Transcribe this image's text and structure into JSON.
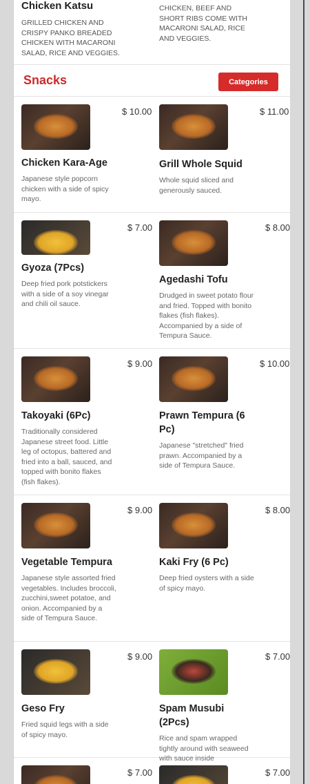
{
  "top": {
    "left": {
      "name": "Chicken Katsu",
      "desc": "GRILLED CHICKEN AND CRISPY PANKO BREADED CHICKEN WITH MACARONI SALAD, RICE AND VEGGIES."
    },
    "right": {
      "desc": "CHICKEN, BEEF AND SHORT RIBS COME WITH MACARONI SALAD, RICE AND VEGGIES."
    }
  },
  "section": {
    "title": "Snacks",
    "categories_label": "Categories"
  },
  "rows": [
    [
      {
        "name": "Chicken Kara-Age",
        "price": "$ 10.00",
        "desc": "Japanese style popcorn chicken with a side of spicy mayo."
      },
      {
        "name": "Grill Whole Squid",
        "price": "$ 11.00",
        "desc": "Whole squid sliced and generously sauced."
      }
    ],
    [
      {
        "name": "Gyoza (7Pcs)",
        "price": "$ 7.00",
        "desc": "Deep fried pork potstickers with a side of a soy vinegar and chili oil sauce."
      },
      {
        "name": "Agedashi Tofu",
        "price": "$ 8.00",
        "desc": "Drudged in sweet potato flour and fried. Topped with bonito flakes (fish flakes). Accompanied by a side of Tempura Sauce."
      }
    ],
    [
      {
        "name": "Takoyaki (6Pc)",
        "price": "$ 9.00",
        "desc": "Traditionally considered Japanese street food. Little leg of octopus, battered and fried into a ball, sauced, and topped with bonito flakes (fish flakes)."
      },
      {
        "name": "Prawn Tempura (6 Pc)",
        "price": "$ 10.00",
        "desc": "Japanese \"stretched\" fried prawn. Accompanied by a side of Tempura Sauce."
      }
    ],
    [
      {
        "name": "Vegetable Tempura",
        "price": "$ 9.00",
        "desc": "Japanese style assorted fried vegetables. Includes broccoli, zucchini,sweet potatoe, and onion. Accompanied by a side of Tempura Sauce."
      },
      {
        "name": "Kaki Fry (6 Pc)",
        "price": "$ 8.00",
        "desc": "Deep fried oysters with a side of spicy mayo."
      }
    ],
    [
      {
        "name": "Geso Fry",
        "price": "$ 9.00",
        "desc": "Fried squid legs with a side of spicy mayo."
      },
      {
        "name": "Spam Musubi (2Pcs)",
        "price": "$ 7.00",
        "desc": "Rice and spam wrapped tightly around with seaweed with sauce inside"
      }
    ],
    [
      {
        "name": "",
        "price": "$ 7.00",
        "desc": ""
      },
      {
        "name": "",
        "price": "$ 7.00",
        "desc": ""
      }
    ]
  ]
}
